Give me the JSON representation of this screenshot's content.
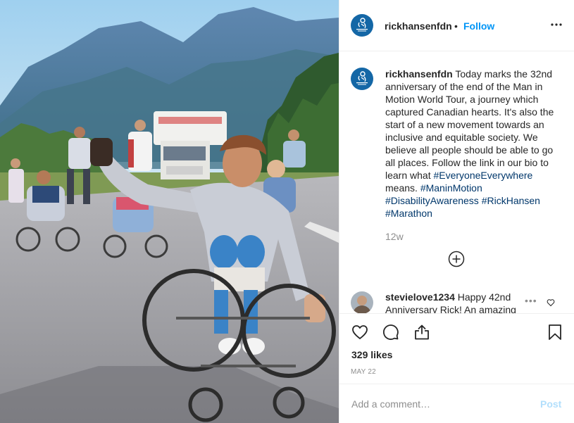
{
  "post": {
    "image_description_icon": "photo-wheelchair-tour",
    "author": "rickhansenfdn",
    "header_separator": "•",
    "follow_label": "Follow",
    "more_icon": "three-dots-icon"
  },
  "caption": {
    "username": "rickhansenfdn",
    "body": "Today marks the 32nd anniversary of the end of the Man in Motion World Tour, a journey which captured Canadian hearts. It's also the start of a new movement towards an inclusive and equitable society. We believe all people should be able to go all places. Follow the link in our bio to learn what",
    "hashtags": [
      "#EveryoneEverywhere",
      "#ManinMotion",
      "#DisabilityAwareness",
      "#RickHansen",
      "#Marathon"
    ],
    "hashtag_tail": "means.",
    "age": "12w",
    "load_more_icon": "plus-circle-icon"
  },
  "comment": {
    "username": "stevielove1234",
    "text": "Happy 42nd Anniversary Rick! An amazing",
    "more": "•••",
    "heart_icon": "heart-icon"
  },
  "actions": {
    "like_icon": "heart-icon",
    "comment_icon": "comment-icon",
    "share_icon": "share-icon",
    "save_icon": "bookmark-icon",
    "likes": "329 likes",
    "date": "MAY 22"
  },
  "composer": {
    "placeholder": "Add a comment…",
    "post_label": "Post"
  },
  "colors": {
    "link": "#0095f6",
    "hashtag": "#00376b",
    "muted": "#8e8e8e",
    "brand_avatar": "#1467a6",
    "post_disabled": "#b2dffc"
  }
}
